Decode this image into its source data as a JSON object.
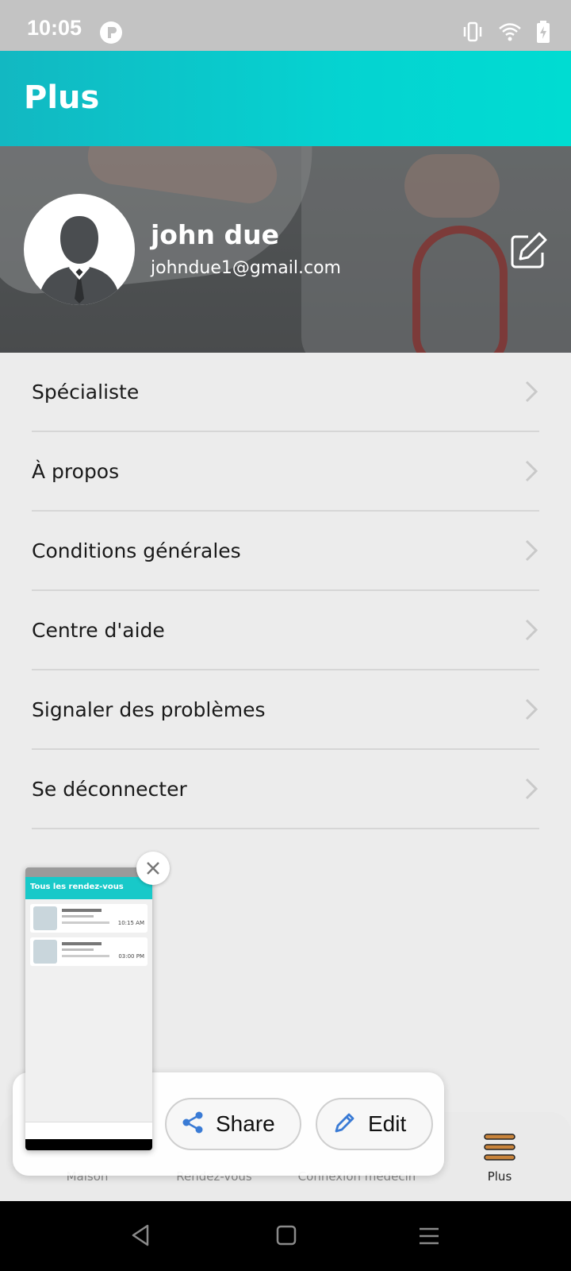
{
  "status_bar": {
    "time": "10:05"
  },
  "app_bar": {
    "title": "Plus"
  },
  "profile": {
    "name": "john due",
    "email": "johndue1@gmail.com"
  },
  "menu": {
    "items": [
      {
        "label": "Spécialiste"
      },
      {
        "label": "À propos"
      },
      {
        "label": "Conditions générales"
      },
      {
        "label": "Centre d'aide"
      },
      {
        "label": "Signaler des problèmes"
      },
      {
        "label": "Se déconnecter"
      }
    ]
  },
  "bottom_nav": {
    "items": [
      {
        "label": "Maison"
      },
      {
        "label": "Rendez-vous"
      },
      {
        "label": "Connexion médecin"
      },
      {
        "label": "Plus"
      }
    ],
    "active": "Plus",
    "active_icon_color": "#c8843c"
  },
  "screenshot_overlay": {
    "preview_title": "Tous les rendez-vous",
    "preview_time_1": "10:15 AM",
    "preview_time_2": "03:00 PM",
    "share_label": "Share",
    "edit_label": "Edit"
  },
  "colors": {
    "appbar": "#05d3d1",
    "accent_blue": "#3a7bd5"
  }
}
